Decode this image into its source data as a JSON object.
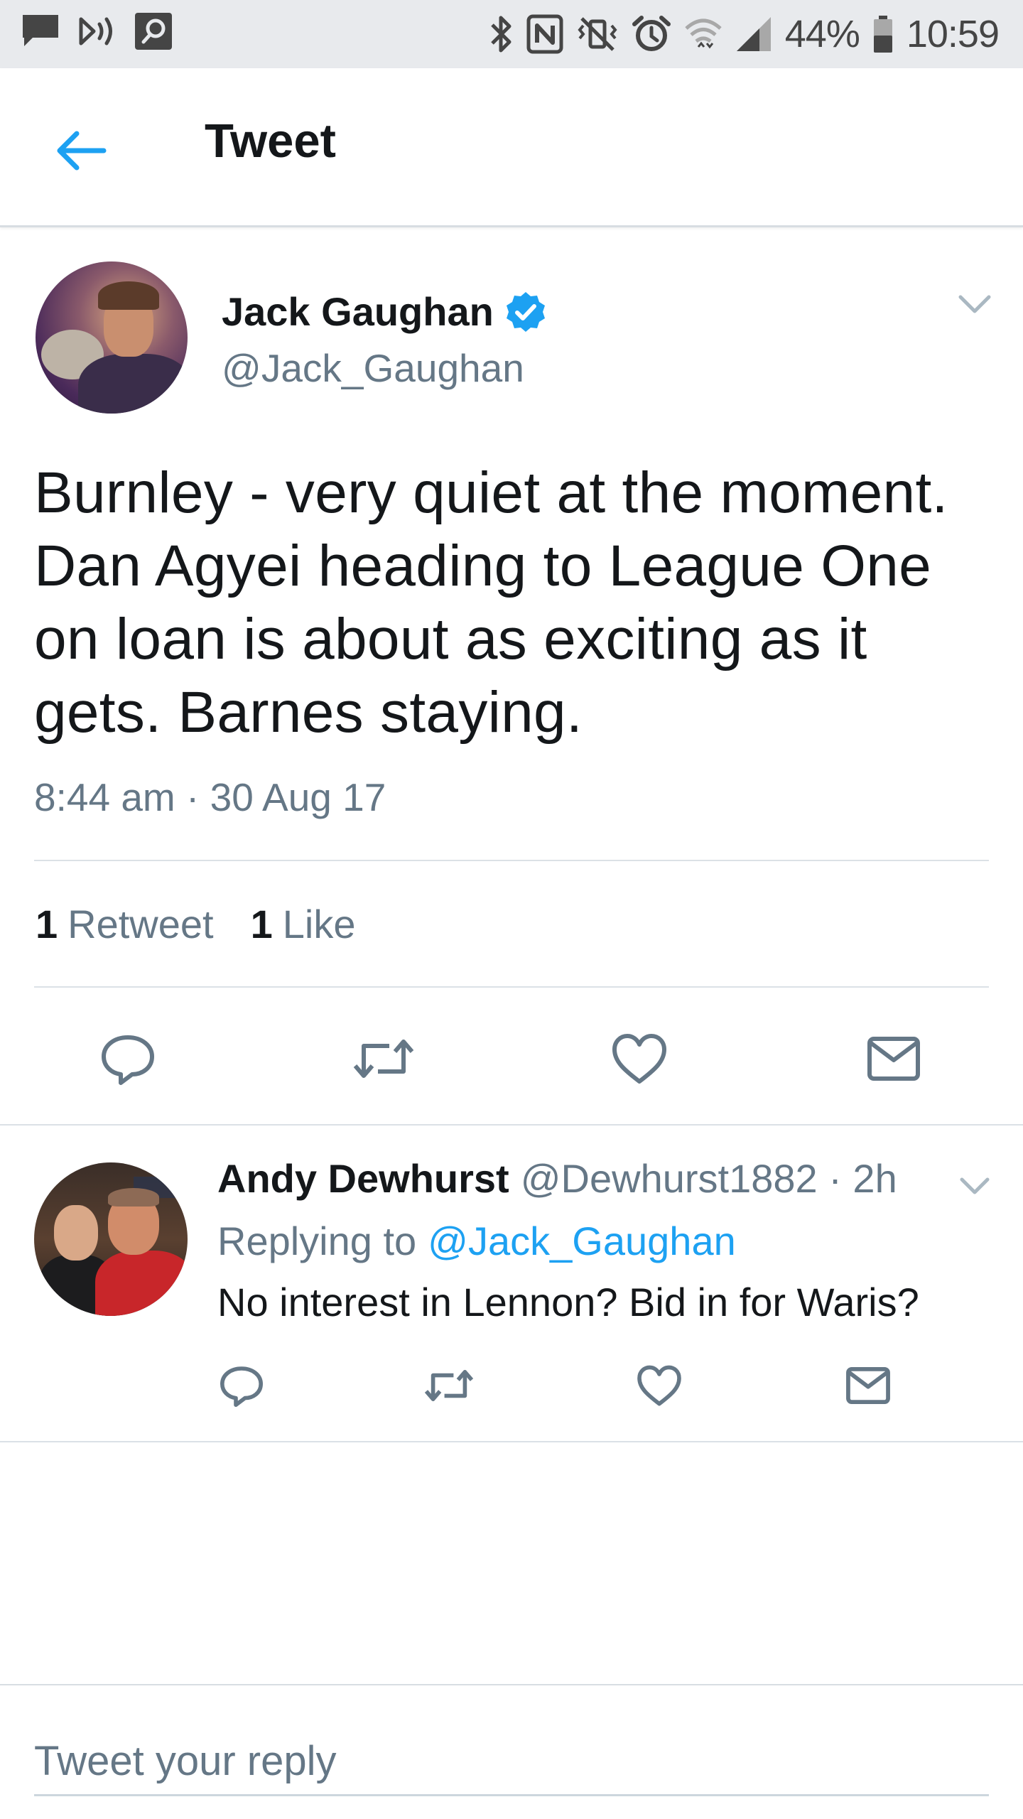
{
  "status_bar": {
    "battery": "44%",
    "time": "10:59"
  },
  "header": {
    "title": "Tweet"
  },
  "tweet": {
    "author_name": "Jack Gaughan",
    "author_handle": "@Jack_Gaughan",
    "verified": true,
    "text": "Burnley - very quiet at the moment. Dan Agyei heading to League One on loan is about as exciting as it gets. Barnes staying.",
    "timestamp": "8:44 am · 30 Aug 17",
    "stats": {
      "retweets_count": "1",
      "retweets_label": "Retweet",
      "likes_count": "1",
      "likes_label": "Like"
    }
  },
  "reply": {
    "author_name": "Andy Dewhurst",
    "author_handle": "@Dewhurst1882",
    "time_ago": "· 2h",
    "replying_to_label": "Replying to",
    "replying_to_handle": "@Jack_Gaughan",
    "text": "No interest in Lennon? Bid in for Waris?"
  },
  "composer": {
    "placeholder": "Tweet your reply"
  },
  "colors": {
    "accent": "#1da1f2",
    "text_primary": "#14171a",
    "text_secondary": "#657786",
    "icon_gray": "#657786",
    "status_bar_bg": "#e8eaed"
  },
  "icons": {
    "status_left": [
      "chat-notification-icon",
      "sound-wave-icon",
      "search-notification-icon"
    ],
    "status_right": [
      "bluetooth-icon",
      "nfc-icon",
      "vibrate-mute-icon",
      "alarm-icon",
      "wifi-icon",
      "signal-icon",
      "battery-icon"
    ],
    "actions": [
      "reply-icon",
      "retweet-icon",
      "like-icon",
      "direct-message-icon"
    ]
  }
}
